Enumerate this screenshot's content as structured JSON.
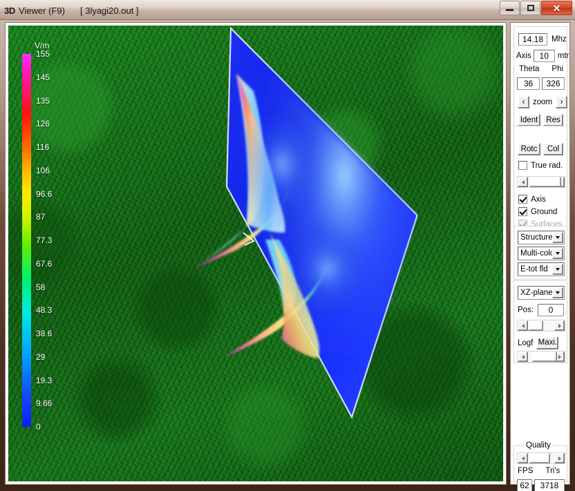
{
  "window": {
    "logo": "3D",
    "title": "Viewer (F9)",
    "file": "[ 3lyagi20.out ]",
    "minimize_label": "–",
    "maximize_label": "",
    "close_label": "✕"
  },
  "scale": {
    "unit": "V/m",
    "ticks": [
      "155",
      "145",
      "135",
      "126",
      "116",
      "106",
      "96.6",
      "87",
      "77.3",
      "67.6",
      "58",
      "48.3",
      "38.6",
      "29",
      "19.3",
      "9.66",
      "0"
    ],
    "max": 155,
    "min": 0,
    "gradient_stops": [
      "#ff2ff4",
      "#ff1010",
      "#ff6a00",
      "#ffe900",
      "#66ef00",
      "#00eae0",
      "#0e1ef5"
    ]
  },
  "panel": {
    "frequency": {
      "value": "14.18",
      "unit": "Mhz"
    },
    "axis": {
      "label": "Axis",
      "value": "10",
      "unit": "mtr"
    },
    "theta": {
      "label": "Theta",
      "value": "36"
    },
    "phi": {
      "label": "Phi",
      "value": "326"
    },
    "zoom": {
      "prev": "‹",
      "label": "zoom",
      "next": "›"
    },
    "buttons": {
      "ident": "Ident",
      "res": "Res",
      "rotc": "Rotc",
      "col": "Col",
      "maxi": "Maxi."
    },
    "true_rad": {
      "label": "True rad.",
      "checked": false
    },
    "checkboxes": [
      {
        "label": "Axis",
        "checked": true,
        "disabled": false
      },
      {
        "label": "Ground",
        "checked": true,
        "disabled": false
      },
      {
        "label": "Surfaces",
        "checked": true,
        "disabled": true
      }
    ],
    "dropdowns": [
      {
        "name": "structure",
        "value": "Structure"
      },
      {
        "name": "coloring",
        "value": "Multi-colo"
      },
      {
        "name": "field",
        "value": "E-tot fld"
      },
      {
        "name": "plane",
        "value": "XZ-plane"
      }
    ],
    "pos": {
      "label": "Pos:",
      "value": "0"
    },
    "logf": {
      "label": "Logf"
    },
    "quality": {
      "title": "Quality",
      "fps_label": "FPS",
      "fps_value": "62",
      "tris_label": "Tri's",
      "tris_value": "3718"
    }
  },
  "scene": {
    "plane_color": "#1226e8",
    "plane_edge_color": "#d8dcf0",
    "ground_color": "#14711a",
    "lobe_count": 2
  }
}
